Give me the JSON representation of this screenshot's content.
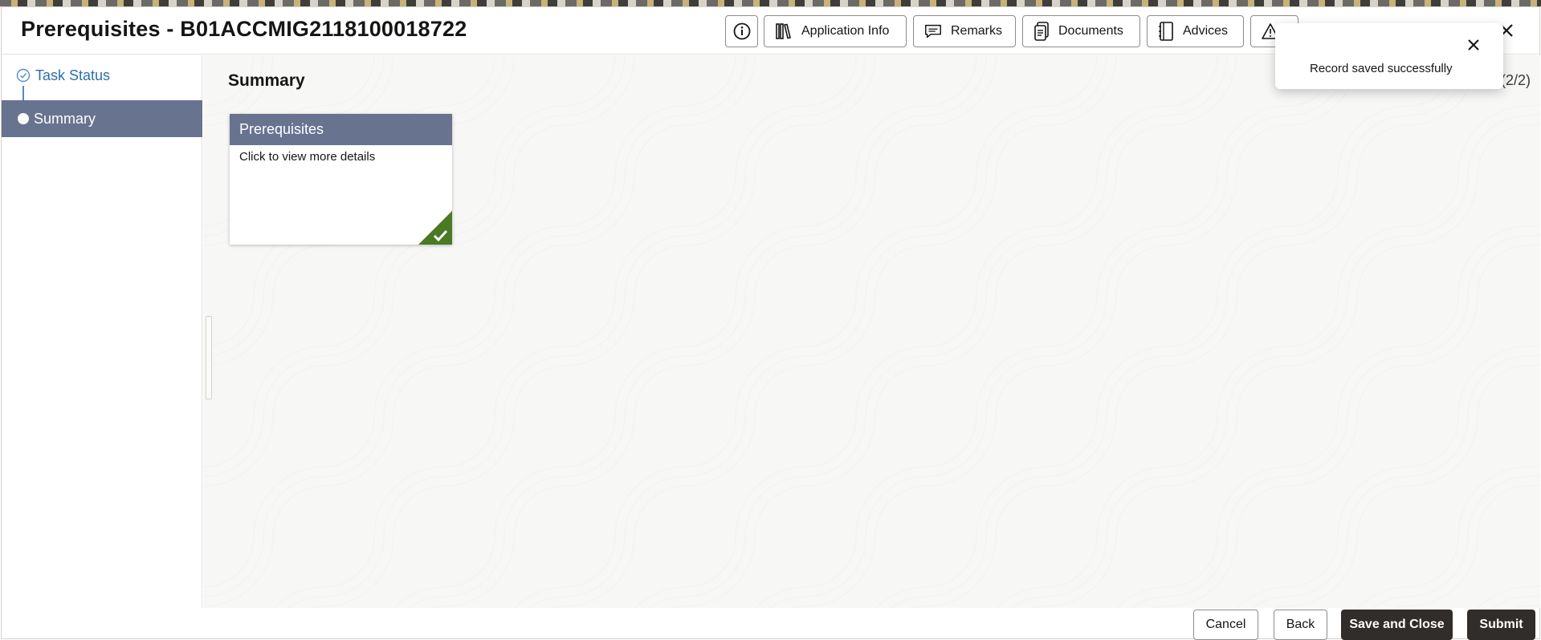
{
  "header": {
    "title": "Prerequisites - B01ACCMIG2118100018722",
    "buttons": {
      "info_icon": "info-icon",
      "application_info": "Application Info",
      "remarks": "Remarks",
      "documents": "Documents",
      "advices": "Advices"
    }
  },
  "nav": {
    "items": [
      {
        "label": "Task Status",
        "state": "completed"
      },
      {
        "label": "Summary",
        "state": "active"
      }
    ]
  },
  "main": {
    "section_title": "Summary",
    "pager": "(2/2)",
    "cards": [
      {
        "title": "Prerequisites",
        "text": "Click to view more details",
        "status": "completed"
      }
    ]
  },
  "footer": {
    "cancel": "Cancel",
    "back": "Back",
    "save_close": "Save and Close",
    "submit": "Submit"
  },
  "toast": {
    "message": "Record saved successfully"
  },
  "colors": {
    "accent": "#687390",
    "primary_button": "#312d2a",
    "success": "#4a7a24",
    "link": "#2c6fa8"
  }
}
